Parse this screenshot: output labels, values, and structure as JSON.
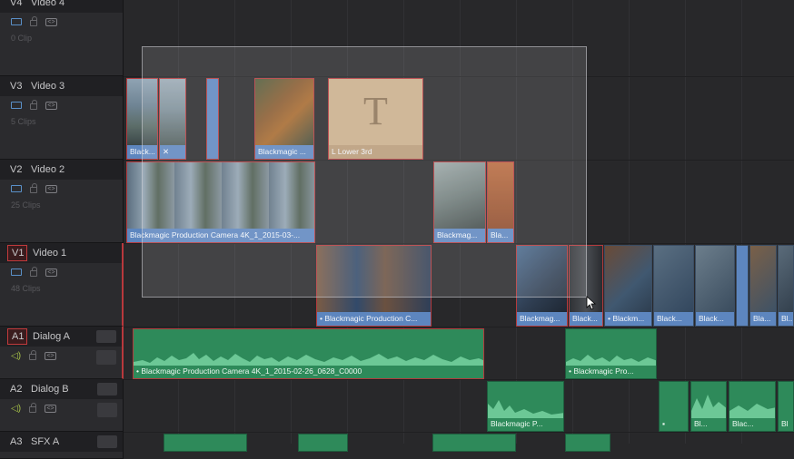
{
  "tracks": {
    "v4": {
      "id": "V4",
      "name": "Video 4",
      "count": "0 Clip"
    },
    "v3": {
      "id": "V3",
      "name": "Video 3",
      "count": "5 Clips"
    },
    "v2": {
      "id": "V2",
      "name": "Video 2",
      "count": "25 Clips"
    },
    "v1": {
      "id": "V1",
      "name": "Video 1",
      "count": "48 Clips"
    },
    "a1": {
      "id": "A1",
      "name": "Dialog A"
    },
    "a2": {
      "id": "A2",
      "name": "Dialog B"
    },
    "a3": {
      "id": "A3",
      "name": "SFX A"
    }
  },
  "clips": {
    "v3_a": "Black...",
    "v3_c": "Blackmagic ...",
    "v3_title_glyph": "T",
    "v3_title": "L Lower 3rd",
    "v2_a": "Blackmagic Production Camera 4K_1_2015-03-...",
    "v2_b": "Blackmag...",
    "v2_c": "Bla...",
    "v1_a": "• Blackmagic Production C...",
    "v1_b": "Blackmag...",
    "v1_c": "Black...",
    "v1_d": "• Blackm...",
    "v1_e": "Black...",
    "v1_f": "Black...",
    "v1_g": "Bla...",
    "v1_h": "Bl...",
    "a1_a": "• Blackmagic Production Camera 4K_1_2015-02-26_0628_C0000",
    "a1_b": "• Blackmagic Pro...",
    "a2_a": "Blackmagic P...",
    "a2_b": "Bl...",
    "a2_c": "Blac...",
    "a2_d": "Bl"
  },
  "icons": {
    "video_visibility": "monitor-icon",
    "lock": "lock-icon",
    "auto_select": "auto-select-icon",
    "speaker": "speaker-icon"
  },
  "colors": {
    "selection_red": "#b43a3d",
    "video_label_blue": "#5d86bf",
    "audio_green": "#2e8a5a",
    "title_tan": "#c9ae8a"
  }
}
